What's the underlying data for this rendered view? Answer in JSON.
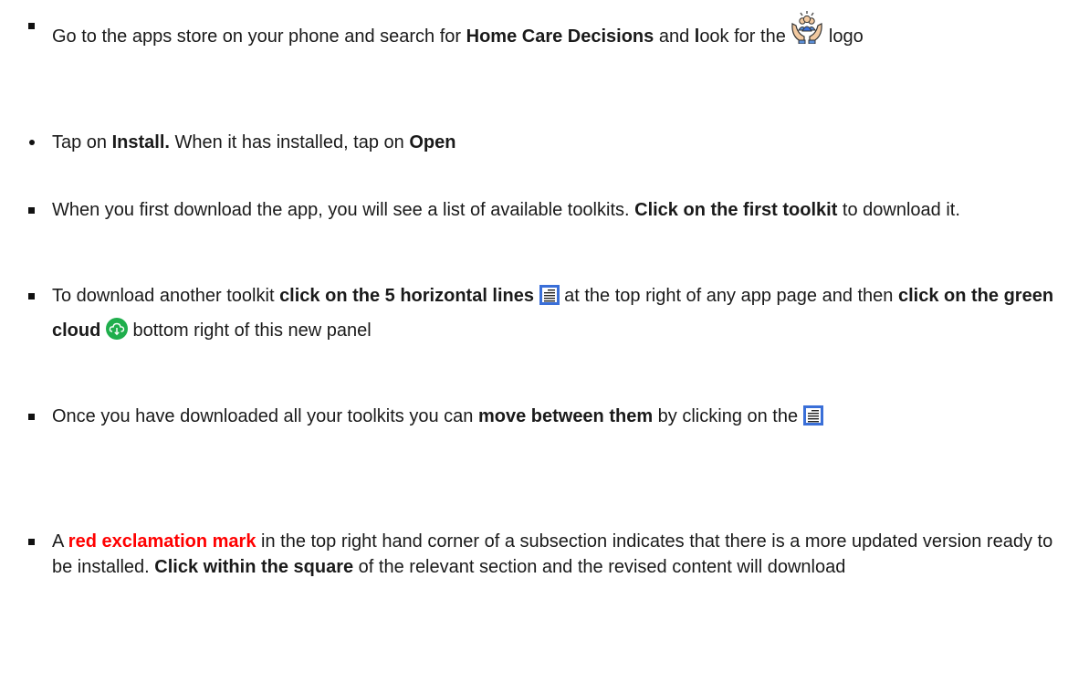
{
  "items": [
    {
      "t1": "Go to the apps store on your phone and search for ",
      "b1": "Home Care Decisions",
      "t2": " and ",
      "b2": "l",
      "t3": "ook for the ",
      "t4": " logo",
      "logo_icon": "hands-holding-people-icon"
    },
    {
      "t1": "Tap on ",
      "b1": "Install.",
      "t2": " When it has installed, tap on ",
      "b2": "Open"
    },
    {
      "t1": "When you first download the app, you will see a list of available toolkits. ",
      "b1": "Click on the first toolkit",
      "t2": " to download it."
    },
    {
      "t1": "To download another toolkit ",
      "b1": "click on the 5 horizontal lines",
      "t2": " at the top right of any app page and then ",
      "b2": "click on the green cloud",
      "t3": " bottom right of this new panel",
      "menu_icon": "hamburger-menu-icon",
      "cloud_icon": "green-cloud-download-icon"
    },
    {
      "t1": "Once you have downloaded all your toolkits you can ",
      "b1": "move between them",
      "t2": " by clicking on the ",
      "menu_icon": "hamburger-menu-icon"
    },
    {
      "t1": "A ",
      "red1": "red exclamation mark",
      "t2": " in the top right hand corner of a subsection indicates that there is a more updated version ready to be installed. ",
      "b1": "Click within the square",
      "t3": " of the relevant section and the revised content will download"
    }
  ],
  "colors": {
    "text": "#1a1a1a",
    "highlight_red": "#ff0000",
    "cloud_green": "#1fae4c",
    "menu_icon_blue": "#3a6fd8"
  }
}
